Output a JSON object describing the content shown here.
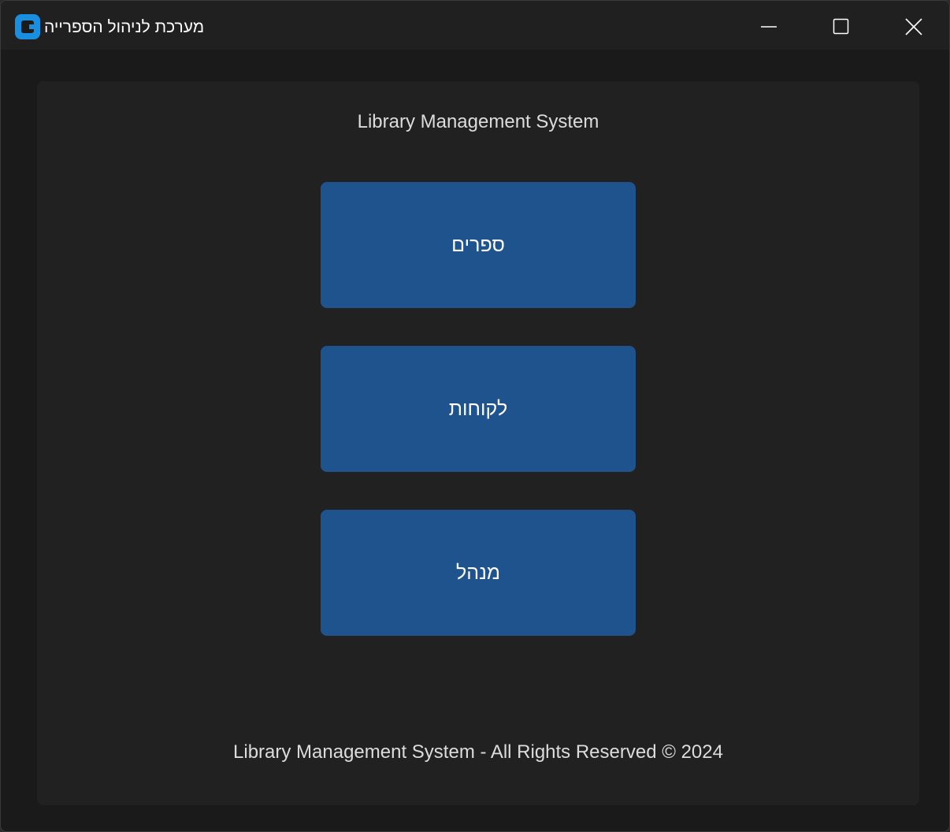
{
  "window": {
    "title": "מערכת לניהול הספרייה",
    "controls": {
      "minimize_icon": "minimize-icon",
      "maximize_icon": "maximize-icon",
      "close_icon": "close-icon"
    }
  },
  "main": {
    "heading": "Library Management System",
    "buttons": [
      {
        "label": "ספרים"
      },
      {
        "label": "לקוחות"
      },
      {
        "label": "מנהל"
      }
    ],
    "footer": "Library Management System - All Rights Reserved © 2024"
  },
  "colors": {
    "window_bg": "#1a1a1a",
    "titlebar_bg": "#202020",
    "panel_bg": "#212121",
    "button_bg": "#1f538d",
    "text_primary": "#dcdcdc",
    "accent_icon": "#1a8fe0"
  }
}
